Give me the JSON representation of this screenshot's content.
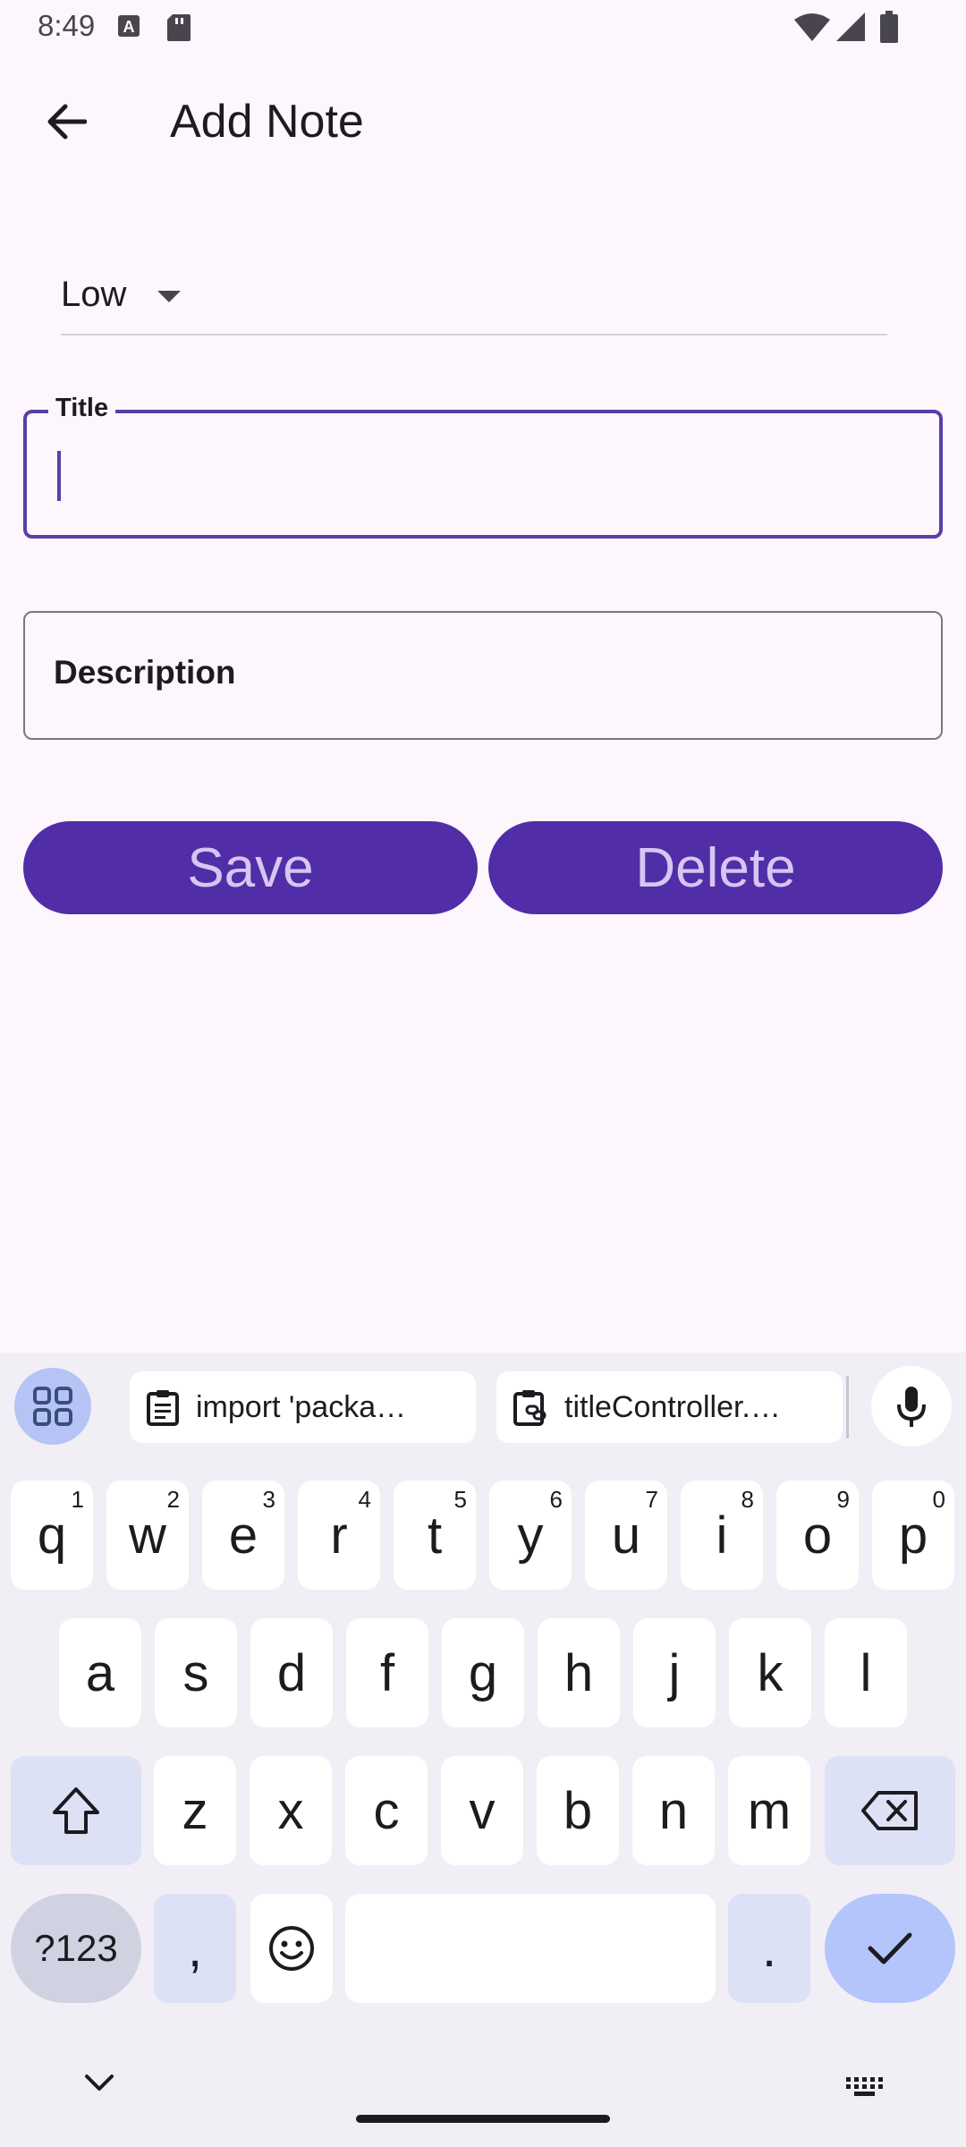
{
  "status_bar": {
    "time": "8:49",
    "icons": [
      "font-a-icon",
      "sd-card-icon",
      "wifi-icon",
      "signal-icon",
      "battery-icon"
    ]
  },
  "app_bar": {
    "title": "Add Note",
    "back_icon": "arrow-back-icon"
  },
  "priority_dropdown": {
    "selected": "Low"
  },
  "form": {
    "title_label": "Title",
    "title_value": "",
    "description_label": "Description"
  },
  "actions": {
    "save_label": "Save",
    "delete_label": "Delete"
  },
  "keyboard": {
    "clipboard": [
      "import 'packa…",
      "titleController.…"
    ],
    "row1": [
      {
        "key": "q",
        "hint": "1"
      },
      {
        "key": "w",
        "hint": "2"
      },
      {
        "key": "e",
        "hint": "3"
      },
      {
        "key": "r",
        "hint": "4"
      },
      {
        "key": "t",
        "hint": "5"
      },
      {
        "key": "y",
        "hint": "6"
      },
      {
        "key": "u",
        "hint": "7"
      },
      {
        "key": "i",
        "hint": "8"
      },
      {
        "key": "o",
        "hint": "9"
      },
      {
        "key": "p",
        "hint": "0"
      }
    ],
    "row2": [
      "a",
      "s",
      "d",
      "f",
      "g",
      "h",
      "j",
      "k",
      "l"
    ],
    "row3": [
      "z",
      "x",
      "c",
      "v",
      "b",
      "n",
      "m"
    ],
    "symbols_label": "?123",
    "comma": ",",
    "period": "."
  },
  "colors": {
    "background": "#fdf7fd",
    "accent": "#512da8",
    "button_text": "#d7c5f2",
    "focus_outline": "#5b3fa6",
    "keyboard_bg": "#f1eef6",
    "enter_key": "#b3c5fa"
  }
}
